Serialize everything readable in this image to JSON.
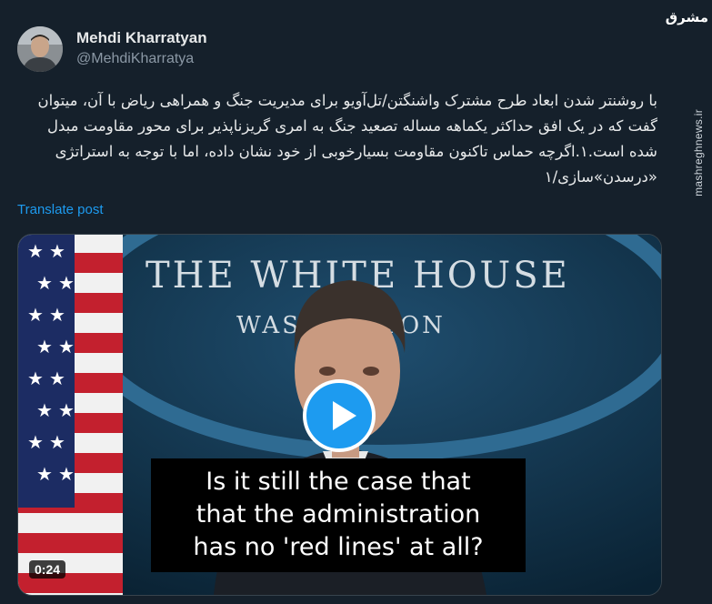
{
  "author": {
    "name": "Mehdi Kharratyan",
    "handle": "@MehdiKharratya"
  },
  "watermark": {
    "logo": "مشرق",
    "site": "mashreghnews.ir"
  },
  "tweet": {
    "text": "با روشنتر شدن ابعاد طرح مشترک واشنگتن/تل‌آویو برای مدیریت جنگ و همراهی ریاض با آن، میتوان گفت که در یک افق حداکثر یکماهه مساله تصعید جنگ به امری گریزناپذیر برای محور مقاومت مبدل شده است.۱.اگرچه حماس تاکنون مقاومت بسیارخوبی از خود نشان داده، اما با توجه به استراتژی «درسدن»سازی/۱",
    "translate_label": "Translate post"
  },
  "media": {
    "backdrop_line1": "THE WHITE HOUSE",
    "backdrop_line2": "WASHINGTON",
    "caption_line1": "Is it still the case that",
    "caption_line2": "that the administration",
    "caption_line3": "has no 'red lines' at all?",
    "duration": "0:24",
    "play_icon": "play-icon"
  },
  "colors": {
    "background": "#15202b",
    "link": "#1d9bf0",
    "play_button": "#1d9bf0"
  }
}
